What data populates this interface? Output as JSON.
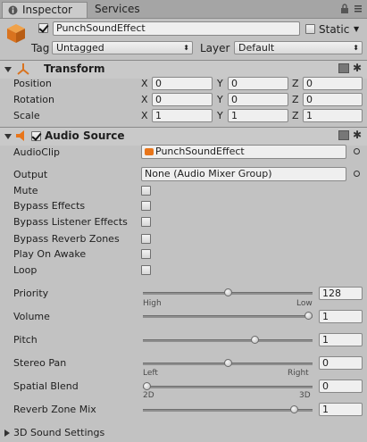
{
  "tabs": [
    {
      "label": "Inspector",
      "active": true
    },
    {
      "label": "Services",
      "active": false
    }
  ],
  "header": {
    "object_name": "PunchSoundEffect",
    "active": true,
    "static_label": "Static",
    "tag_label": "Tag",
    "tag_value": "Untagged",
    "layer_label": "Layer",
    "layer_value": "Default"
  },
  "transform": {
    "title": "Transform",
    "rows": [
      {
        "label": "Position",
        "x": "0",
        "y": "0",
        "z": "0"
      },
      {
        "label": "Rotation",
        "x": "0",
        "y": "0",
        "z": "0"
      },
      {
        "label": "Scale",
        "x": "1",
        "y": "1",
        "z": "1"
      }
    ],
    "axis_labels": {
      "x": "X",
      "y": "Y",
      "z": "Z"
    }
  },
  "audio_source": {
    "title": "Audio Source",
    "enabled": true,
    "audioclip_label": "AudioClip",
    "audioclip_value": "PunchSoundEffect",
    "output_label": "Output",
    "output_value": "None (Audio Mixer Group)",
    "toggles": [
      {
        "label": "Mute",
        "checked": false
      },
      {
        "label": "Bypass Effects",
        "checked": false
      },
      {
        "label": "Bypass Listener Effects",
        "checked": false
      },
      {
        "label": "Bypass Reverb Zones",
        "checked": false
      },
      {
        "label": "Play On Awake",
        "checked": false
      },
      {
        "label": "Loop",
        "checked": false
      }
    ],
    "sliders": [
      {
        "label": "Priority",
        "value": "128",
        "fraction": 0.5,
        "min_label": "High",
        "max_label": "Low"
      },
      {
        "label": "Volume",
        "value": "1",
        "fraction": 1.0
      },
      {
        "label": "Pitch",
        "value": "1",
        "fraction": 0.67
      },
      {
        "label": "Stereo Pan",
        "value": "0",
        "fraction": 0.5,
        "min_label": "Left",
        "max_label": "Right"
      },
      {
        "label": "Spatial Blend",
        "value": "0",
        "fraction": 0.0,
        "min_label": "2D",
        "max_label": "3D"
      },
      {
        "label": "Reverb Zone Mix",
        "value": "1",
        "fraction": 0.91
      }
    ],
    "sound_settings_label": "3D Sound Settings"
  },
  "colors": {
    "accent_orange": "#e8751a",
    "panel_bg": "#c2c2c2"
  },
  "icons": {
    "object": "cube-icon",
    "transform": "transform-axes-icon",
    "audio": "speaker-icon",
    "help": "book-help-icon",
    "settings": "gear-icon"
  }
}
